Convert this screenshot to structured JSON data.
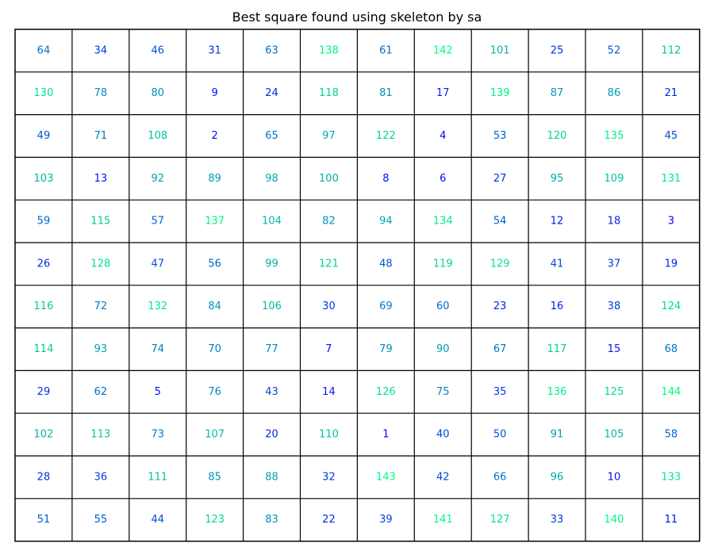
{
  "chart_data": {
    "type": "table",
    "title": "Best square found using skeleton by sa",
    "rows": 12,
    "cols": 12,
    "value_range": [
      1,
      144
    ],
    "colormap": {
      "low": "#0000ff",
      "high": "#00ff80"
    },
    "grid_color": "#000000",
    "values": [
      [
        64,
        34,
        46,
        31,
        63,
        138,
        61,
        142,
        101,
        25,
        52,
        112
      ],
      [
        130,
        78,
        80,
        9,
        24,
        118,
        81,
        17,
        139,
        87,
        86,
        21
      ],
      [
        49,
        71,
        108,
        2,
        65,
        97,
        122,
        4,
        53,
        120,
        135,
        45
      ],
      [
        103,
        13,
        92,
        89,
        98,
        100,
        8,
        6,
        27,
        95,
        109,
        131
      ],
      [
        59,
        115,
        57,
        137,
        104,
        82,
        94,
        134,
        54,
        12,
        18,
        3
      ],
      [
        26,
        128,
        47,
        56,
        99,
        121,
        48,
        119,
        129,
        41,
        37,
        19
      ],
      [
        116,
        72,
        132,
        84,
        106,
        30,
        69,
        60,
        23,
        16,
        38,
        124
      ],
      [
        114,
        93,
        74,
        70,
        77,
        7,
        79,
        90,
        67,
        117,
        15,
        68
      ],
      [
        29,
        62,
        5,
        76,
        43,
        14,
        126,
        75,
        35,
        136,
        125,
        144
      ],
      [
        102,
        113,
        73,
        107,
        20,
        110,
        1,
        40,
        50,
        91,
        105,
        58
      ],
      [
        28,
        36,
        111,
        85,
        88,
        32,
        143,
        42,
        66,
        96,
        10,
        133
      ],
      [
        51,
        55,
        44,
        123,
        83,
        22,
        39,
        141,
        127,
        33,
        140,
        11
      ]
    ]
  }
}
